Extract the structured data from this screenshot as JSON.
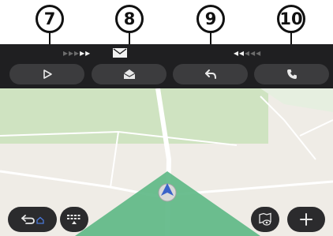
{
  "callouts": [
    "7",
    "8",
    "9",
    "10"
  ],
  "notification_bar": {
    "left_indicator": "play-next-arrows",
    "center_icon": "mail-icon",
    "right_indicator": "rewind-arrows"
  },
  "actions": [
    {
      "id": "play",
      "icon": "play-icon"
    },
    {
      "id": "message",
      "icon": "mail-icon"
    },
    {
      "id": "reply",
      "icon": "reply-icon"
    },
    {
      "id": "call",
      "icon": "phone-icon"
    }
  ],
  "map": {
    "colors": {
      "background": "#efece6",
      "park": "#cfe3c1",
      "road": "#ffffff",
      "route_cone": "#5fb887",
      "position_marker": "#3a63c9"
    }
  },
  "controls": [
    "back-home-button",
    "apps-grid-button",
    "map-view-button",
    "add-button"
  ]
}
